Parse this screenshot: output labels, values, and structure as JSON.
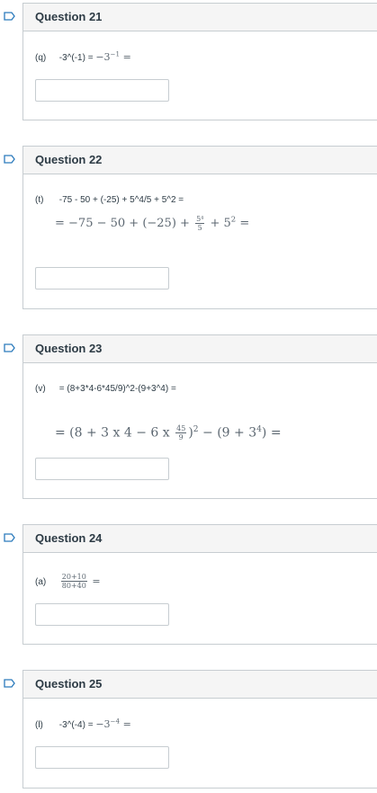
{
  "questions": [
    {
      "title": "Question 21",
      "label": "(q)",
      "text": "-3^(-1) = ",
      "math": {
        "a": "−3",
        "exp": "−1",
        "eq": "="
      }
    },
    {
      "title": "Question 22",
      "label": "(t)",
      "text": "-75 - 50 + (-25) + 5^4/5 + 5^2  =",
      "math": {
        "pre": "= −75 − 50 + (−25) + ",
        "frac_num": "5⁴",
        "frac_den": "5",
        "post": "+ 5",
        "post_exp": "2",
        "eq": "="
      }
    },
    {
      "title": "Question 23",
      "label": "(v)",
      "text": "= (8+3*4-6*45/9)^2-(9+3^4) =",
      "math": {
        "pre": "= (8 + 3 x 4 − 6 x ",
        "frac_num": "45",
        "frac_den": "9",
        "close": ")",
        "exp": "2",
        "mid": " − (9 + 3",
        "mid_exp": "4",
        "post": ") ="
      }
    },
    {
      "title": "Question 24",
      "label": "(a)",
      "math": {
        "frac_num": "20+10",
        "frac_den": "80+40",
        "eq": "="
      }
    },
    {
      "title": "Question 25",
      "label": "(l)",
      "text": "-3^(-4) =",
      "math": {
        "a": "−3",
        "exp": "−4",
        "eq": "="
      }
    }
  ],
  "colors": {
    "flag": "#2b7abc",
    "border": "#c7cdd1",
    "header_bg": "#f5f5f5"
  },
  "icons": {
    "flag": "flag-icon"
  }
}
